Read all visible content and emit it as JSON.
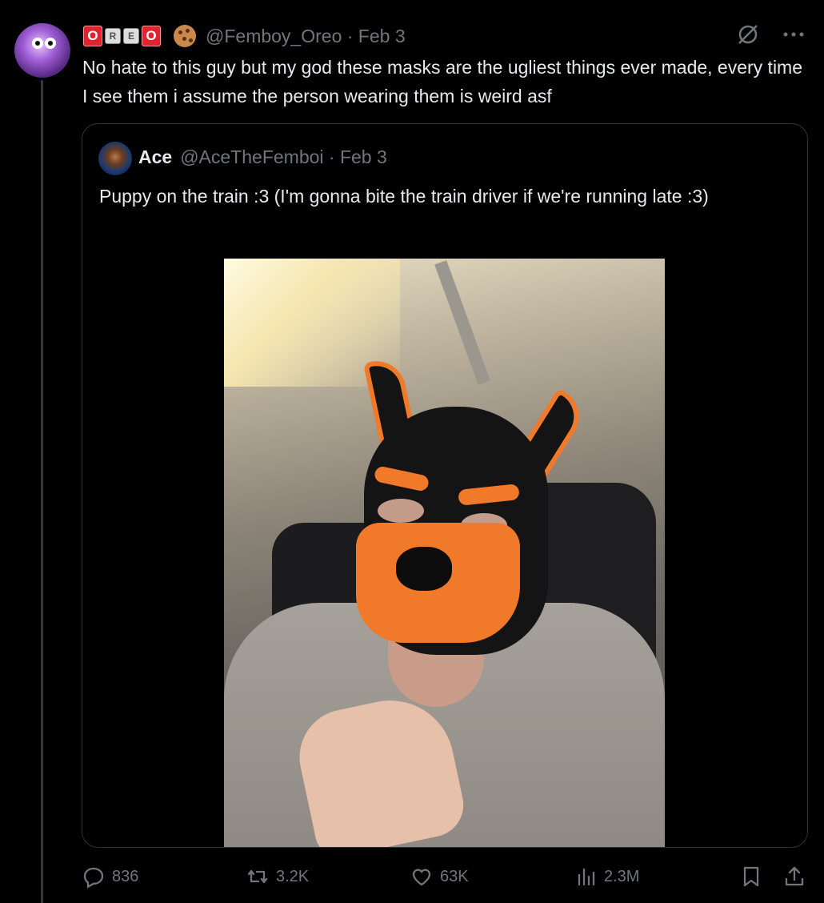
{
  "author": {
    "display_name_badge": [
      "O",
      "R",
      "E",
      "O"
    ],
    "handle": "@Femboy_Oreo",
    "date": "· Feb 3",
    "text": "No hate to this guy but my god these masks are the ugliest things ever made, every time I see them i assume the person wearing them is weird asf"
  },
  "top_actions": {
    "grok_icon": "grok-icon",
    "more_icon": "more-icon"
  },
  "quote": {
    "name": "Ace",
    "handle": "@AceTheFemboi",
    "date": "· Feb 3",
    "text": "Puppy on the train :3 (I'm gonna bite the train driver if we're running late :3)"
  },
  "actions": {
    "replies": "836",
    "reposts": "3.2K",
    "likes": "63K",
    "views": "2.3M"
  },
  "colors": {
    "background": "#000000",
    "text": "#e7e9ea",
    "muted": "#71767b",
    "border": "#2f3336",
    "badge_red": "#e0242f"
  }
}
